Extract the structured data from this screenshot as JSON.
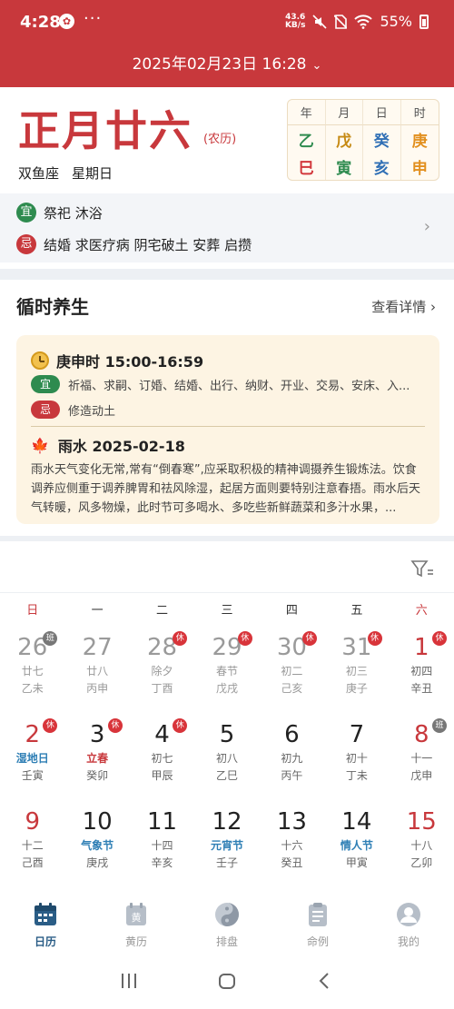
{
  "status_bar": {
    "time": "4:28",
    "badge": "✿",
    "dots": "···",
    "speed_top": "43.6",
    "speed_bottom": "KB/s",
    "battery": "55%"
  },
  "header": {
    "date_selector": "2025年02月23日 16:28"
  },
  "lunar": {
    "date": "正月廿六",
    "tag": "(农历)",
    "constellation": "双鱼座",
    "weekday": "星期日",
    "ganzhi": {
      "headers": [
        "年",
        "月",
        "日",
        "时"
      ],
      "stems": [
        "乙",
        "戊",
        "癸",
        "庚"
      ],
      "branches": [
        "巳",
        "寅",
        "亥",
        "申"
      ],
      "colors": {
        "wood": "#2e8b4f",
        "earth": "#c68a14",
        "water": "#2f6fb5",
        "metal": "#e2901f",
        "fire": "#d2383c"
      }
    }
  },
  "yiji": {
    "yi_label": "宜",
    "yi_text": "祭祀 沐浴",
    "ji_label": "忌",
    "ji_text": "结婚 求医疗病 阴宅破土 安葬 启攒"
  },
  "health": {
    "title": "循时养生",
    "more": "查看详情 ›",
    "hour": "庚申时  15:00-16:59",
    "yi_label": "宜",
    "yi_text": "祈福、求嗣、订婚、结婚、出行、纳财、开业、交易、安床、入...",
    "ji_label": "忌",
    "ji_text": "修造动土",
    "term": "雨水  2025-02-18",
    "term_text": "雨水天气变化无常,常有“倒春寒”,应采取积极的精神调摄养生锻炼法。饮食调养应侧重于调养脾胃和祛风除湿，起居方面则要特别注意春捂。雨水后天气转暖，风多物燥，此时节可多喝水、多吃些新鲜蔬菜和多汁水果，..."
  },
  "calendar": {
    "weekdays": [
      "日",
      "一",
      "二",
      "三",
      "四",
      "五",
      "六"
    ],
    "days": [
      {
        "n": "26",
        "l1": "廿七",
        "l2": "乙未",
        "dim": true,
        "badge": "班"
      },
      {
        "n": "27",
        "l1": "廿八",
        "l2": "丙申",
        "dim": true,
        "badge": ""
      },
      {
        "n": "28",
        "l1": "除夕",
        "l2": "丁酉",
        "dim": true,
        "badge": "休"
      },
      {
        "n": "29",
        "l1": "春节",
        "l2": "戊戌",
        "dim": true,
        "badge": "休"
      },
      {
        "n": "30",
        "l1": "初二",
        "l2": "己亥",
        "dim": true,
        "badge": "休"
      },
      {
        "n": "31",
        "l1": "初三",
        "l2": "庚子",
        "dim": true,
        "badge": "休"
      },
      {
        "n": "1",
        "l1": "初四",
        "l2": "辛丑",
        "dim": false,
        "badge": "休"
      },
      {
        "n": "2",
        "l1": "湿地日",
        "l2": "壬寅",
        "dim": false,
        "badge": "休",
        "l1type": "fest"
      },
      {
        "n": "3",
        "l1": "立春",
        "l2": "癸卯",
        "dim": false,
        "badge": "休",
        "l1type": "term"
      },
      {
        "n": "4",
        "l1": "初七",
        "l2": "甲辰",
        "dim": false,
        "badge": "休"
      },
      {
        "n": "5",
        "l1": "初八",
        "l2": "乙巳",
        "dim": false,
        "badge": ""
      },
      {
        "n": "6",
        "l1": "初九",
        "l2": "丙午",
        "dim": false,
        "badge": ""
      },
      {
        "n": "7",
        "l1": "初十",
        "l2": "丁未",
        "dim": false,
        "badge": ""
      },
      {
        "n": "8",
        "l1": "十一",
        "l2": "戊申",
        "dim": false,
        "badge": "班"
      },
      {
        "n": "9",
        "l1": "十二",
        "l2": "己酉",
        "dim": false,
        "badge": ""
      },
      {
        "n": "10",
        "l1": "气象节",
        "l2": "庚戌",
        "dim": false,
        "badge": "",
        "l1type": "fest"
      },
      {
        "n": "11",
        "l1": "十四",
        "l2": "辛亥",
        "dim": false,
        "badge": ""
      },
      {
        "n": "12",
        "l1": "元宵节",
        "l2": "壬子",
        "dim": false,
        "badge": "",
        "l1type": "fest"
      },
      {
        "n": "13",
        "l1": "十六",
        "l2": "癸丑",
        "dim": false,
        "badge": ""
      },
      {
        "n": "14",
        "l1": "情人节",
        "l2": "甲寅",
        "dim": false,
        "badge": "",
        "l1type": "fest"
      },
      {
        "n": "15",
        "l1": "十八",
        "l2": "乙卯",
        "dim": false,
        "badge": ""
      }
    ]
  },
  "bottom_nav": {
    "items": [
      {
        "label": "日历",
        "icon": "calendar-icon",
        "active": true
      },
      {
        "label": "黄历",
        "icon": "almanac-icon",
        "active": false
      },
      {
        "label": "排盘",
        "icon": "yin-yang-icon",
        "active": false
      },
      {
        "label": "命例",
        "icon": "clipboard-icon",
        "active": false
      },
      {
        "label": "我的",
        "icon": "profile-icon",
        "active": false
      }
    ]
  },
  "colors": {
    "brand_red": "#c8383c",
    "accent_blue": "#2a5d86",
    "yi_green": "#2e8b4f"
  }
}
